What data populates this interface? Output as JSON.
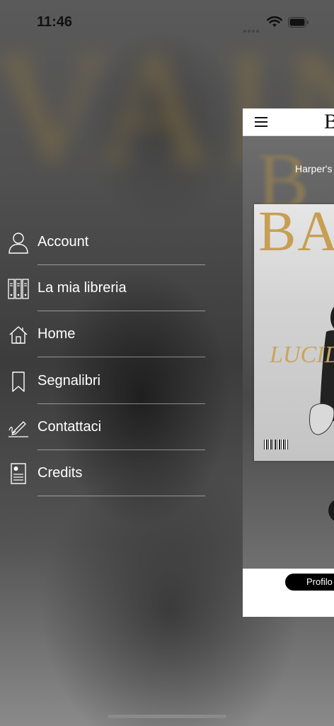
{
  "status_bar": {
    "time": "11:46"
  },
  "menu": {
    "items": [
      {
        "label": "Account",
        "icon": "person-icon"
      },
      {
        "label": "La mia libreria",
        "icon": "library-icon"
      },
      {
        "label": "Home",
        "icon": "home-icon"
      },
      {
        "label": "Segnalibri",
        "icon": "bookmark-icon"
      },
      {
        "label": "Contattaci",
        "icon": "signature-pen-icon"
      },
      {
        "label": "Credits",
        "icon": "id-card-icon"
      }
    ]
  },
  "content": {
    "header_logo": "B",
    "subtitle": "Harper's",
    "cover": {
      "title": "BAZ",
      "headline": "LUCID"
    },
    "footer_button": "Profilo"
  },
  "colors": {
    "menu_text": "#ffffff",
    "accent_gold": "#c79f52"
  }
}
